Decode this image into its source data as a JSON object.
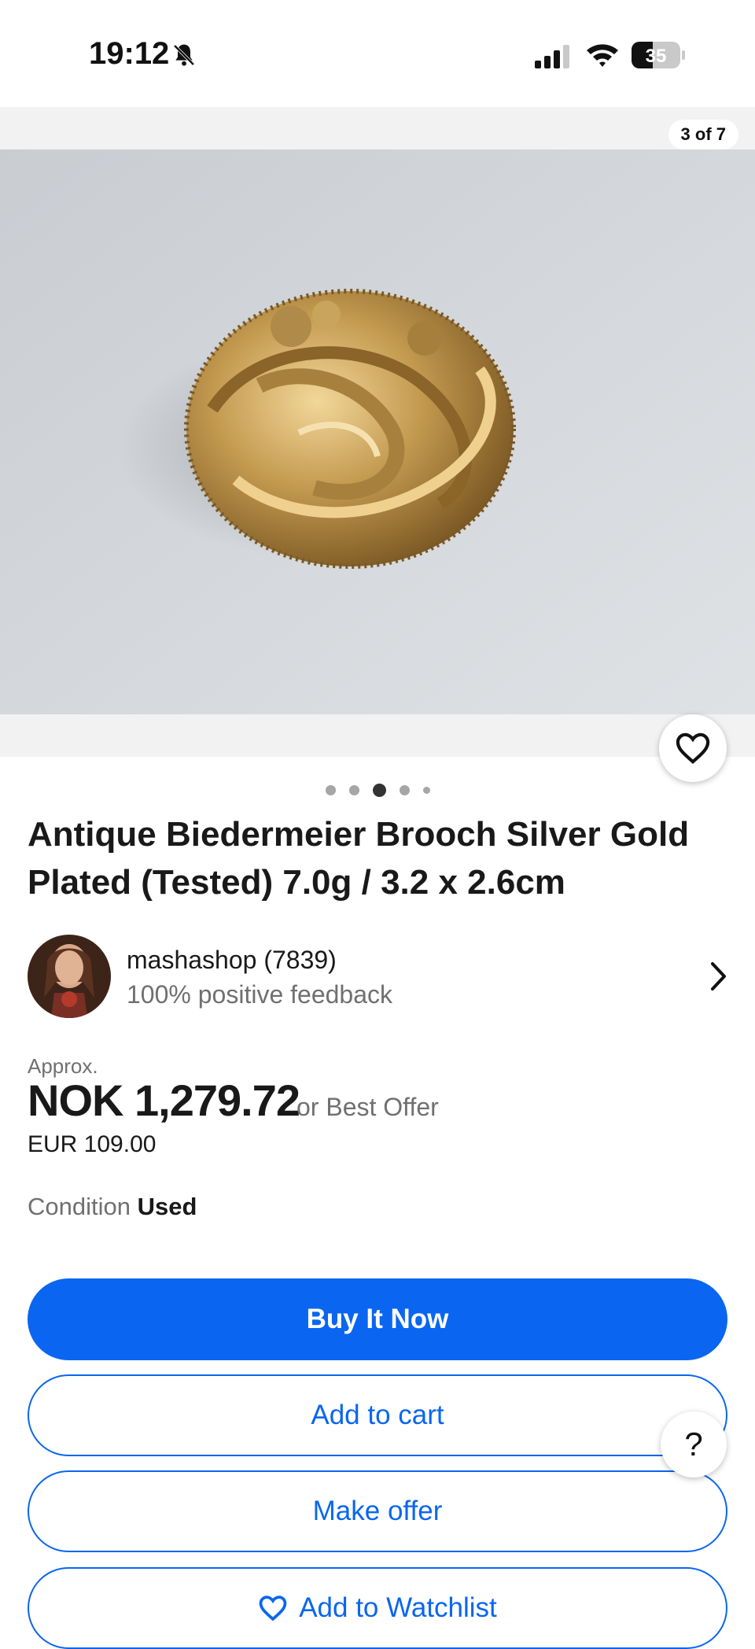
{
  "status_bar": {
    "time": "19:12",
    "battery": "35"
  },
  "gallery": {
    "counter": "3 of 7",
    "dots_total": 5,
    "dots_active_index": 2
  },
  "listing": {
    "title": "Antique Biedermeier Brooch Silver Gold Plated (Tested) 7.0g / 3.2 x 2.6cm"
  },
  "seller": {
    "name": "mashashop (7839)",
    "feedback": "100% positive feedback"
  },
  "price": {
    "approx_label": "Approx.",
    "amount": "NOK 1,279.72",
    "best_offer": "or Best Offer",
    "original": "EUR 109.00"
  },
  "condition": {
    "label": "Condition",
    "value": "Used"
  },
  "actions": {
    "buy_now": "Buy It Now",
    "add_to_cart": "Add to cart",
    "make_offer": "Make offer",
    "add_to_watchlist": "Add to Watchlist"
  },
  "help": {
    "label": "?"
  },
  "colors": {
    "accent": "#0a66f0",
    "muted": "#707070",
    "text": "#191919"
  }
}
